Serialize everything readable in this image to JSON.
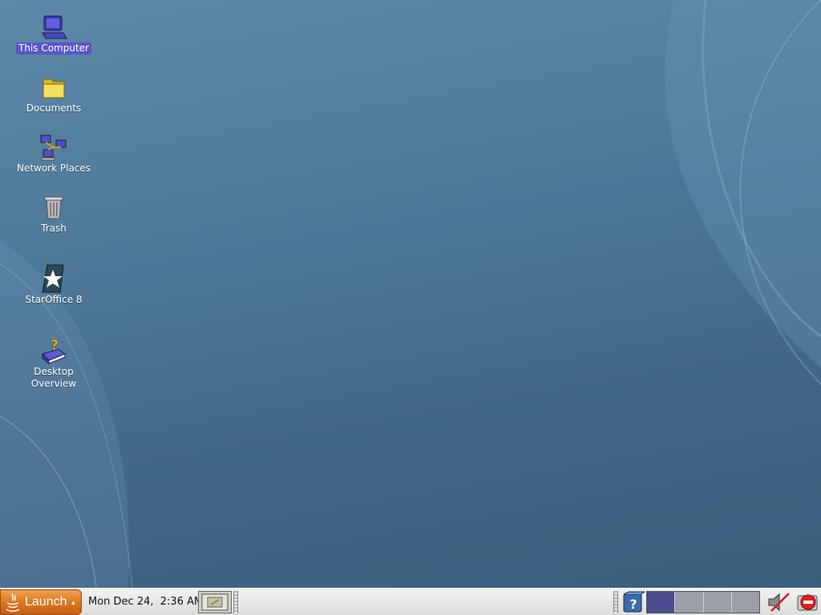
{
  "desktop": {
    "background_color": "#4f7a9a",
    "icons": [
      {
        "label": "This Computer",
        "icon": "computer-icon",
        "selected": true
      },
      {
        "label": "Documents",
        "icon": "folder-icon"
      },
      {
        "label": "Network Places",
        "icon": "network-icon"
      },
      {
        "label": "Trash",
        "icon": "trash-icon"
      },
      {
        "label": "StarOffice 8",
        "icon": "staroffice-icon"
      },
      {
        "label": "Desktop Overview",
        "icon": "help-book-icon"
      }
    ]
  },
  "panel": {
    "launch_label": "Launch",
    "clock": "Mon Dec 24,  2:36 AM",
    "workspaces": {
      "count": 4,
      "active_index": 0
    },
    "accent_color": "#d9741e"
  }
}
